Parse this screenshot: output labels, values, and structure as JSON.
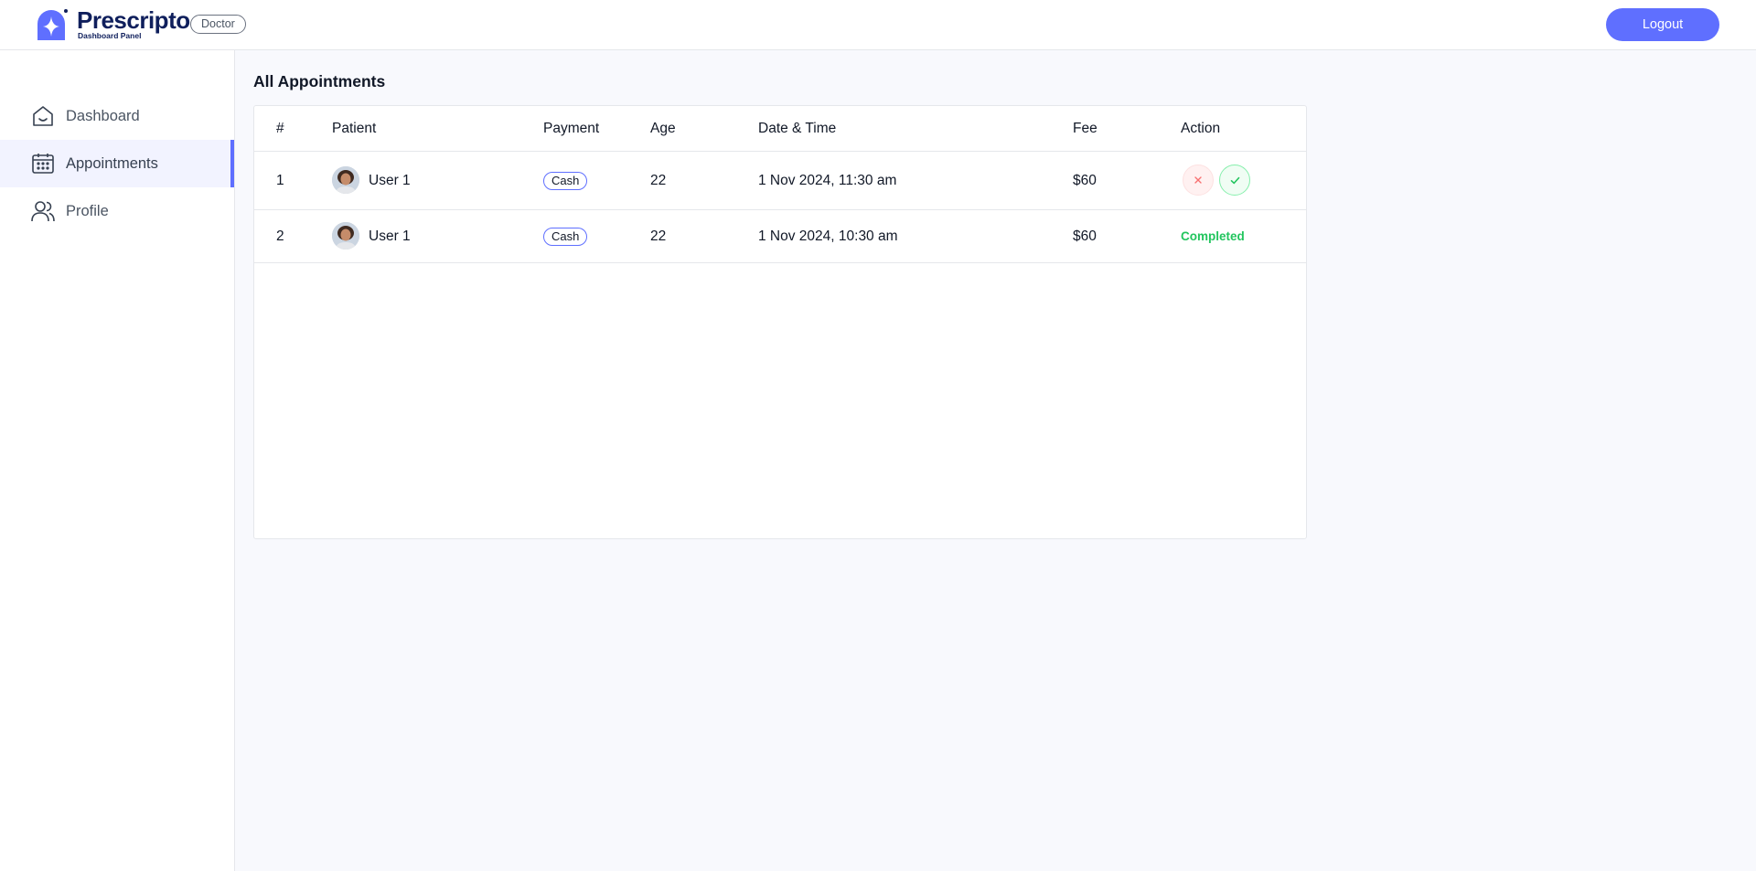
{
  "header": {
    "brand_title": "Prescripto",
    "brand_subtitle": "Dashboard Panel",
    "role": "Doctor",
    "logout_label": "Logout",
    "accent_color": "#5F6FFF"
  },
  "sidebar": {
    "items": [
      {
        "label": "Dashboard",
        "icon": "home-icon",
        "active": false
      },
      {
        "label": "Appointments",
        "icon": "calendar-icon",
        "active": true
      },
      {
        "label": "Profile",
        "icon": "people-icon",
        "active": false
      }
    ]
  },
  "main": {
    "title": "All Appointments",
    "columns": [
      "#",
      "Patient",
      "Payment",
      "Age",
      "Date & Time",
      "Fee",
      "Action"
    ],
    "rows": [
      {
        "index": "1",
        "patient": "User 1",
        "payment": "Cash",
        "age": "22",
        "datetime": "1 Nov 2024, 11:30 am",
        "fee": "$60",
        "action": "buttons",
        "action_icons": [
          "cancel-x-icon",
          "complete-check-icon"
        ]
      },
      {
        "index": "2",
        "patient": "User 1",
        "payment": "Cash",
        "age": "22",
        "datetime": "1 Nov 2024, 10:30 am",
        "fee": "$60",
        "action": "status",
        "status": "Completed",
        "status_color": "#22c55e"
      }
    ]
  }
}
